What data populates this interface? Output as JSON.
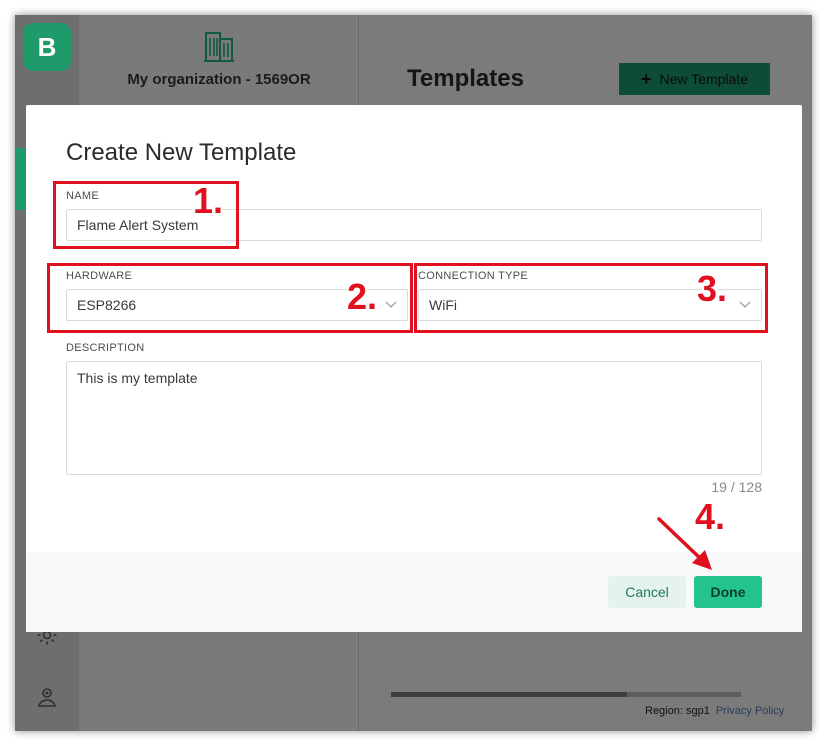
{
  "sidebar": {
    "logo_letter": "B"
  },
  "organization": {
    "name": "My organization - 1569OR"
  },
  "main": {
    "title": "Templates",
    "new_template_label": "New Template",
    "region": "Region: sgp1",
    "privacy": "Privacy Policy"
  },
  "modal": {
    "title": "Create New Template",
    "name_label": "NAME",
    "name_value": "Flame Alert System",
    "hardware_label": "HARDWARE",
    "hardware_value": "ESP8266",
    "connection_label": "CONNECTION TYPE",
    "connection_value": "WiFi",
    "description_label": "DESCRIPTION",
    "description_value": "This is my template",
    "counter": "19 / 128",
    "cancel_label": "Cancel",
    "done_label": "Done"
  },
  "annotations": {
    "step1": "1.",
    "step2": "2.",
    "step3": "3.",
    "step4": "4.",
    "color": "#e0101e"
  },
  "colors": {
    "brand": "#23c48e",
    "brand_dark": "#1f9a6a"
  },
  "icons": [
    "building-icon",
    "gear-icon",
    "user-icon",
    "chevron-down-icon",
    "plus-icon",
    "arrow-icon"
  ]
}
